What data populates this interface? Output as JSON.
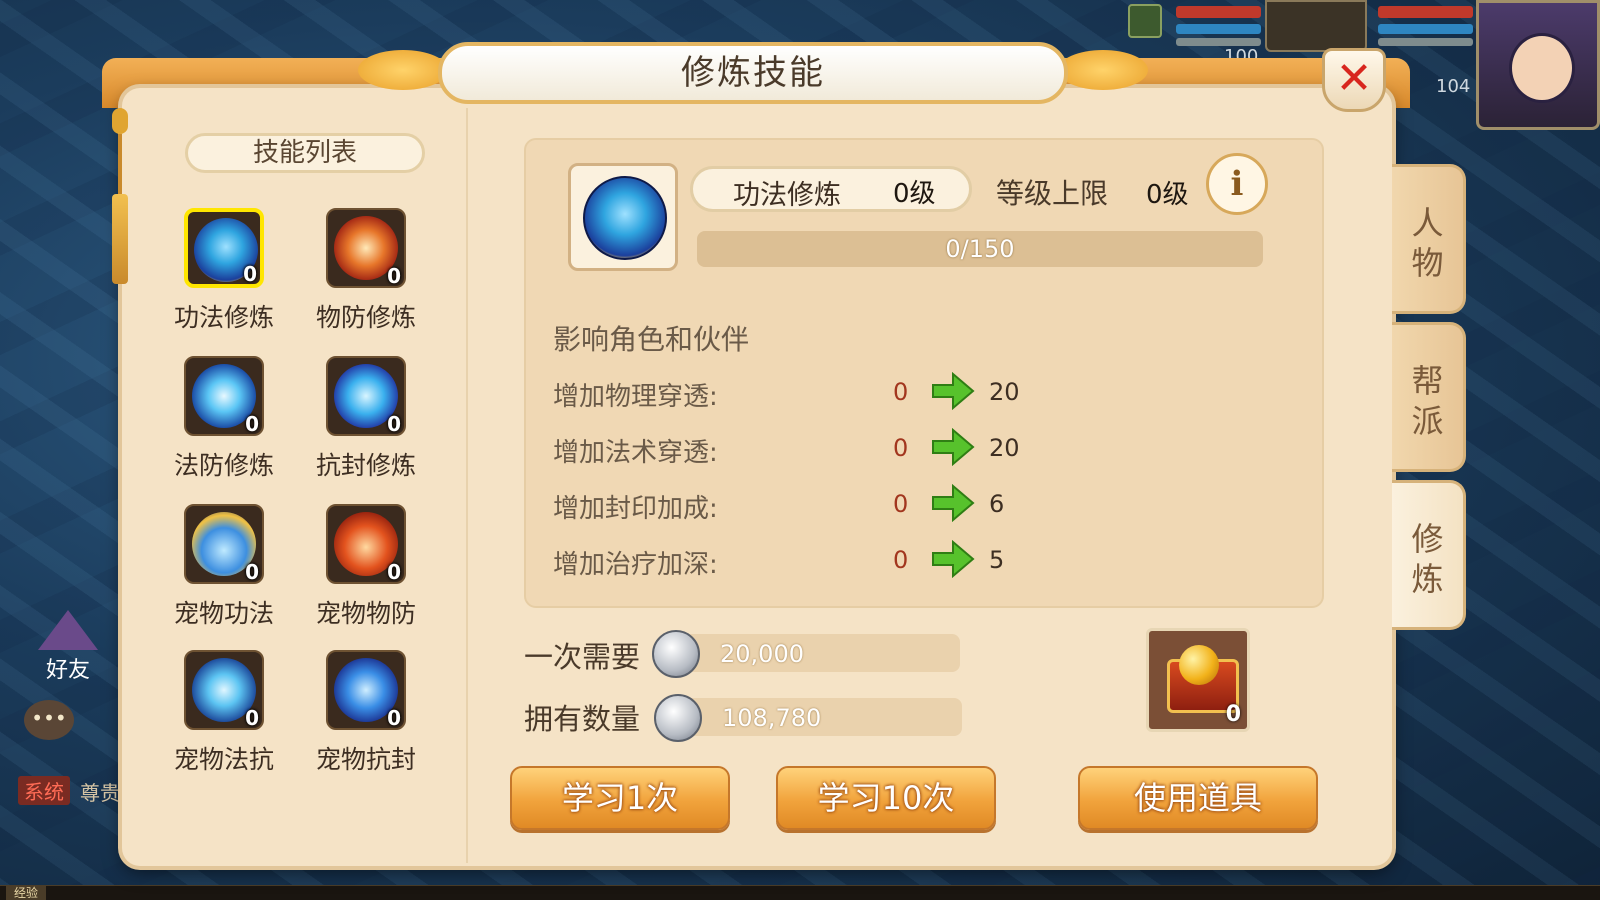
{
  "hud": {
    "pet_level": "100",
    "hero_level": "104",
    "friend_label": "好友",
    "chat_icon": "chat-bubble-icon",
    "system_tag": "系统",
    "system_text": "尊贵",
    "xp_label": "经验"
  },
  "window": {
    "title": "修炼技能",
    "close_icon": "close-x-icon"
  },
  "skill_list": {
    "title": "技能列表",
    "items": [
      {
        "name": "功法修炼",
        "level": "0",
        "icon": "blue-dragon-orb-icon",
        "selected": true
      },
      {
        "name": "物防修炼",
        "level": "0",
        "icon": "red-armor-orb-icon",
        "selected": false
      },
      {
        "name": "法防修炼",
        "level": "0",
        "icon": "blue-shield-orb-icon",
        "selected": false
      },
      {
        "name": "抗封修炼",
        "level": "0",
        "icon": "blue-swirl-orb-icon",
        "selected": false
      },
      {
        "name": "宠物功法",
        "level": "0",
        "icon": "pet-blue-flame-icon",
        "selected": false
      },
      {
        "name": "宠物物防",
        "level": "0",
        "icon": "pet-red-flame-icon",
        "selected": false
      },
      {
        "name": "宠物法抗",
        "level": "0",
        "icon": "pet-blue-lightning-icon",
        "selected": false
      },
      {
        "name": "宠物抗封",
        "level": "0",
        "icon": "pet-blue-star-icon",
        "selected": false
      }
    ]
  },
  "detail": {
    "skill_name": "功法修炼",
    "skill_level": "0级",
    "cap_label": "等级上限",
    "cap_value": "0级",
    "info_icon": "info-icon",
    "progress_text": "0/150",
    "progress_current": 0,
    "progress_max": 150,
    "affects_label": "影响角色和伙伴",
    "stats": [
      {
        "label": "增加物理穿透:",
        "current": "0",
        "next": "20"
      },
      {
        "label": "增加法术穿透:",
        "current": "0",
        "next": "20"
      },
      {
        "label": "增加封印加成:",
        "current": "0",
        "next": "6"
      },
      {
        "label": "增加治疗加深:",
        "current": "0",
        "next": "5"
      }
    ]
  },
  "cost": {
    "need_label": "一次需要",
    "need_value": "20,000",
    "own_label": "拥有数量",
    "own_value": "108,780",
    "coin_icon": "silver-coin-icon"
  },
  "item": {
    "icon": "treasure-chest-icon",
    "count": "0"
  },
  "buttons": {
    "learn_once": "学习1次",
    "learn_ten": "学习10次",
    "use_item": "使用道具"
  },
  "side_tabs": [
    {
      "label": "人物",
      "active": false
    },
    {
      "label": "帮派",
      "active": false
    },
    {
      "label": "修炼",
      "active": true
    }
  ],
  "colors": {
    "panel_bg": "#f5e3c6",
    "title_orange": "#e39a35",
    "selected_border": "#ffe600",
    "close_red": "#d8261e",
    "button_orange": "#f1a33c",
    "stat_current_red": "#a2361e"
  }
}
